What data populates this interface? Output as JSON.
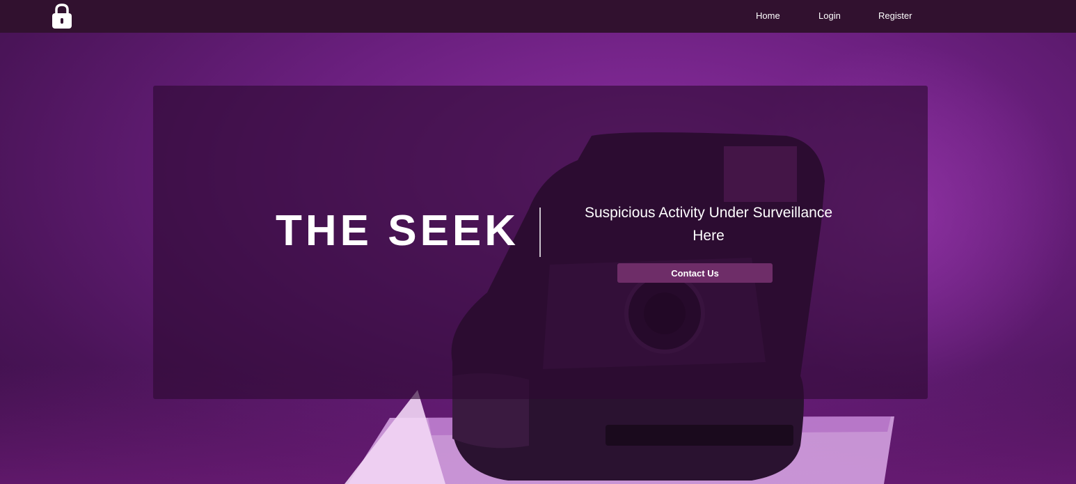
{
  "nav": {
    "logo_icon": "lock-icon",
    "links": [
      {
        "label": "Home"
      },
      {
        "label": "Login"
      },
      {
        "label": "Register"
      }
    ]
  },
  "hero": {
    "title": "THE SEEK",
    "tagline_line1": "Suspicious Activity Under Surveillance",
    "tagline_line2": "Here",
    "button_label": "Contact Us"
  },
  "colors": {
    "navbar": "#31112f",
    "accent": "#6e2d68",
    "background": "#6a1f7e"
  }
}
